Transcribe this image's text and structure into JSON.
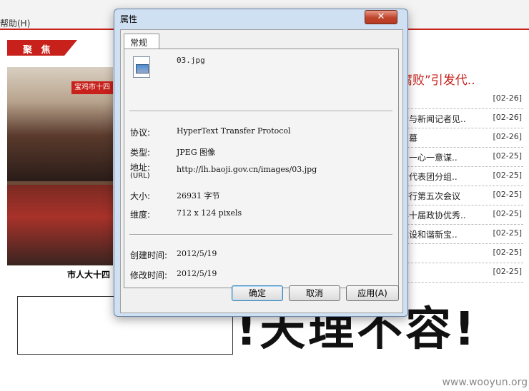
{
  "browser": {
    "menu_help": "帮助(H)",
    "focus_label": "聚 焦",
    "photo_banner": "宝鸡市十四",
    "photo_caption": "市人大十四",
    "headline": "腐败”引发代..",
    "news": [
      {
        "title": "",
        "date": "[02-26]"
      },
      {
        "title": "会与新闻记者见..",
        "date": "[02-26]"
      },
      {
        "title": "闭幕",
        "date": "[02-26]"
      },
      {
        "title": "：一心一意谋..",
        "date": "[02-25]"
      },
      {
        "title": "大代表团分组..",
        "date": "[02-25]"
      },
      {
        "title": "举行第五次会议",
        "date": "[02-25]"
      },
      {
        "title": "彰十届政协优秀..",
        "date": "[02-25]"
      },
      {
        "title": "建设和谐新宝..",
        "date": "[02-25]"
      },
      {
        "title": "",
        "date": "[02-25]"
      },
      {
        "title": "",
        "date": "[02-25]"
      }
    ],
    "big_slogan": "!天理不容!",
    "watermark": "www.wooyun.org"
  },
  "dialog": {
    "title": "属性",
    "close_symbol": "✕",
    "tab_general": "常规",
    "file_icon": "image-file-icon",
    "filename": "03.jpg",
    "properties": {
      "protocol_label": "协议:",
      "protocol_value": "HyperText Transfer Protocol",
      "type_label": "类型:",
      "type_value": "JPEG 图像",
      "address_label": "地址:",
      "address_sub": "(URL)",
      "address_value": "http://lh.baoji.gov.cn/images/03.jpg",
      "size_label": "大小:",
      "size_value": "26931 字节",
      "dimensions_label": "维度:",
      "dimensions_value": "712  x  124  pixels",
      "created_label": "创建时间:",
      "created_value": "2012/5/19",
      "modified_label": "修改时间:",
      "modified_value": "2012/5/19"
    },
    "buttons": {
      "ok": "确定",
      "cancel": "取消",
      "apply": "应用(A)"
    }
  }
}
